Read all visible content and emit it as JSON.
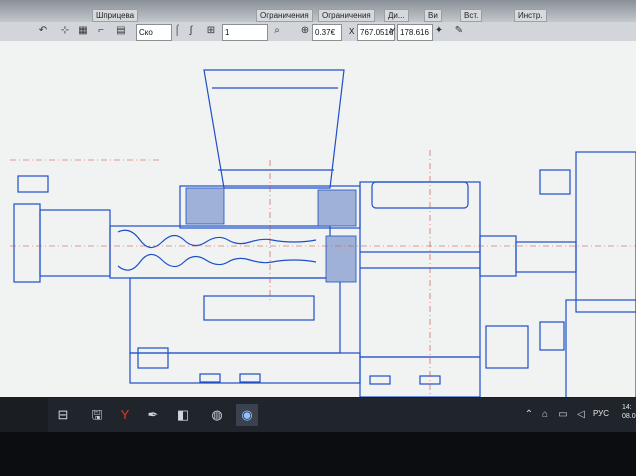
{
  "window": {
    "tabs": [
      "Шприцева",
      "Ограничения",
      "Ограничения",
      "Ди...",
      "Ви",
      "Вст.",
      "Инстр."
    ]
  },
  "toolbar": {
    "style_value": "Ско",
    "layer_value": "1",
    "zoom_value": "0.37€",
    "coord_x_label": "X",
    "coord_x_value": "767.051€",
    "coord_y_label": "Y",
    "coord_y_value": "178.616"
  },
  "taskbar": {
    "language": "РУС",
    "time": "14:",
    "date": "08.0"
  },
  "icons": [
    "windows-icon",
    "save-icon",
    "yandex-icon",
    "feather-icon",
    "app-icon",
    "kompas-icon",
    "network-icon",
    "volume-icon"
  ]
}
